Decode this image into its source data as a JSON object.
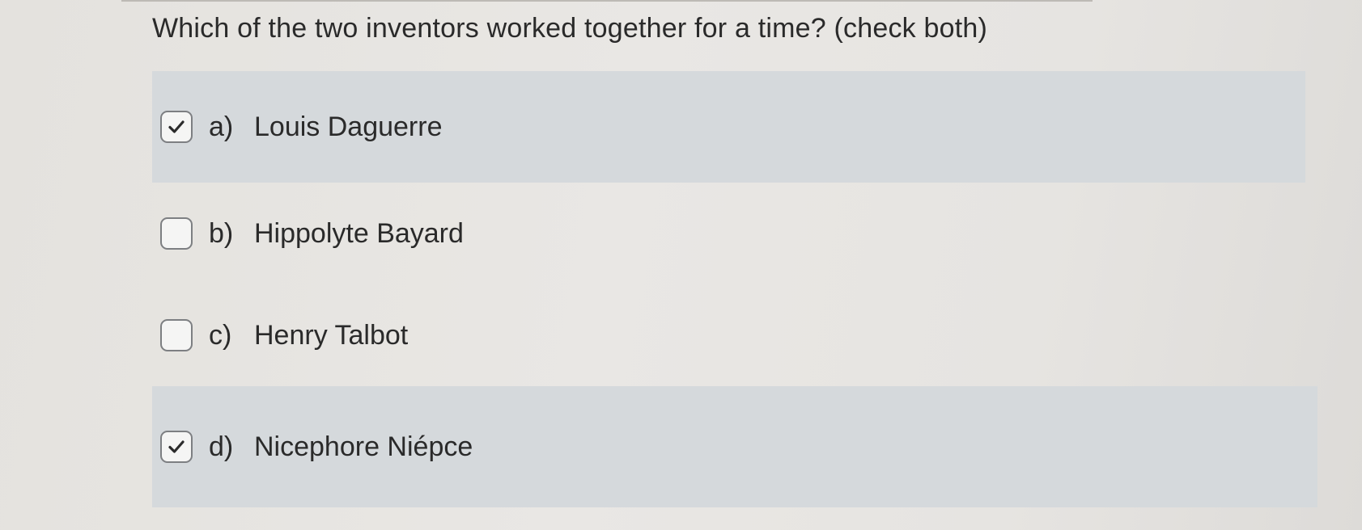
{
  "question": {
    "text": "Which of the two inventors worked together for a time? (check both)"
  },
  "options": [
    {
      "letter": "a)",
      "label": "Louis Daguerre",
      "checked": true
    },
    {
      "letter": "b)",
      "label": "Hippolyte Bayard",
      "checked": false
    },
    {
      "letter": "c)",
      "label": "Henry Talbot",
      "checked": false
    },
    {
      "letter": "d)",
      "label": "Nicephore Niépce",
      "checked": true
    }
  ],
  "icons": {
    "checked": "checkmark-icon"
  },
  "colors": {
    "selected_row_background": "#d5d9dc",
    "checkbox_border": "#7d7f82",
    "text": "#2a2a2a"
  }
}
